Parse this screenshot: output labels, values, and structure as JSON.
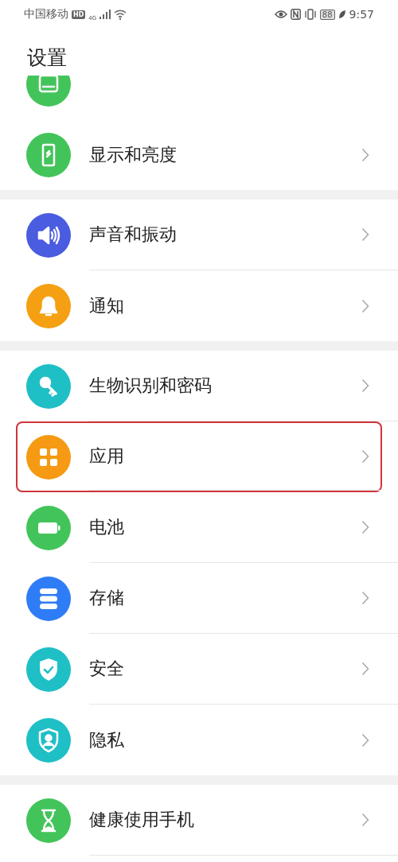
{
  "status_bar": {
    "carrier": "中国移动",
    "hd_badge": "HD",
    "network": "4G",
    "battery": "88",
    "time": "9:57"
  },
  "title": "设置",
  "groups": [
    {
      "items": [
        {
          "kind": "wallpaper",
          "color": "#43c45a",
          "highlighted": false
        }
      ]
    },
    {
      "items": [
        {
          "kind": "display",
          "color": "#43c45a",
          "label": "显示和亮度",
          "highlighted": false
        }
      ]
    },
    {
      "items": [
        {
          "kind": "sound",
          "color": "#4a5ce0",
          "label": "声音和振动",
          "highlighted": false
        },
        {
          "kind": "bell",
          "color": "#f5a012",
          "label": "通知",
          "highlighted": false
        }
      ]
    },
    {
      "items": [
        {
          "kind": "key",
          "color": "#1fbfc6",
          "label": "生物识别和密码",
          "highlighted": false
        },
        {
          "kind": "apps",
          "color": "#f59a12",
          "label": "应用",
          "highlighted": true
        },
        {
          "kind": "battery",
          "color": "#43c45a",
          "label": "电池",
          "highlighted": false
        },
        {
          "kind": "storage",
          "color": "#2f7df6",
          "label": "存储",
          "highlighted": false
        },
        {
          "kind": "shield",
          "color": "#1fbfc6",
          "label": "安全",
          "highlighted": false
        },
        {
          "kind": "privacy",
          "color": "#1fbfc6",
          "label": "隐私",
          "highlighted": false
        }
      ]
    },
    {
      "items": [
        {
          "kind": "hourglass",
          "color": "#43c45a",
          "label": "健康使用手机",
          "highlighted": false
        }
      ]
    }
  ]
}
